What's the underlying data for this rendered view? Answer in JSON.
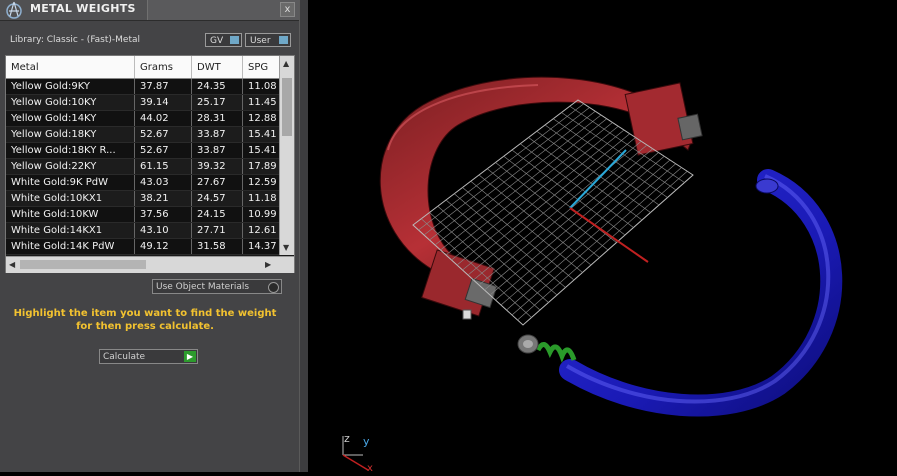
{
  "panel": {
    "title": "METAL WEIGHTS",
    "close_label": "x",
    "library_label": "Library: Classic - (Fast)-Metal",
    "toggle_gv": "GV",
    "toggle_user": "User",
    "table": {
      "headers": [
        "Metal",
        "Grams",
        "DWT",
        "SPG"
      ],
      "rows": [
        [
          "Yellow Gold:9KY",
          "37.87",
          "24.35",
          "11.08"
        ],
        [
          "Yellow Gold:10KY",
          "39.14",
          "25.17",
          "11.45"
        ],
        [
          "Yellow Gold:14KY",
          "44.02",
          "28.31",
          "12.88"
        ],
        [
          "Yellow Gold:18KY",
          "52.67",
          "33.87",
          "15.41"
        ],
        [
          "Yellow Gold:18KY R...",
          "52.67",
          "33.87",
          "15.41"
        ],
        [
          "Yellow Gold:22KY",
          "61.15",
          "39.32",
          "17.89"
        ],
        [
          "White Gold:9K PdW",
          "43.03",
          "27.67",
          "12.59"
        ],
        [
          "White Gold:10KX1",
          "38.21",
          "24.57",
          "11.18"
        ],
        [
          "White Gold:10KW",
          "37.56",
          "24.15",
          "10.99"
        ],
        [
          "White Gold:14KX1",
          "43.10",
          "27.71",
          "12.61"
        ],
        [
          "White Gold:14K PdW",
          "49.12",
          "31.58",
          "14.37"
        ]
      ]
    },
    "use_object_materials": "Use Object Materials",
    "instruction": "Highlight the item you want to find the weight for then press calculate.",
    "calculate_label": "Calculate"
  },
  "viewport": {
    "axis_labels": {
      "z": "z",
      "y": "y",
      "x": "x"
    }
  }
}
